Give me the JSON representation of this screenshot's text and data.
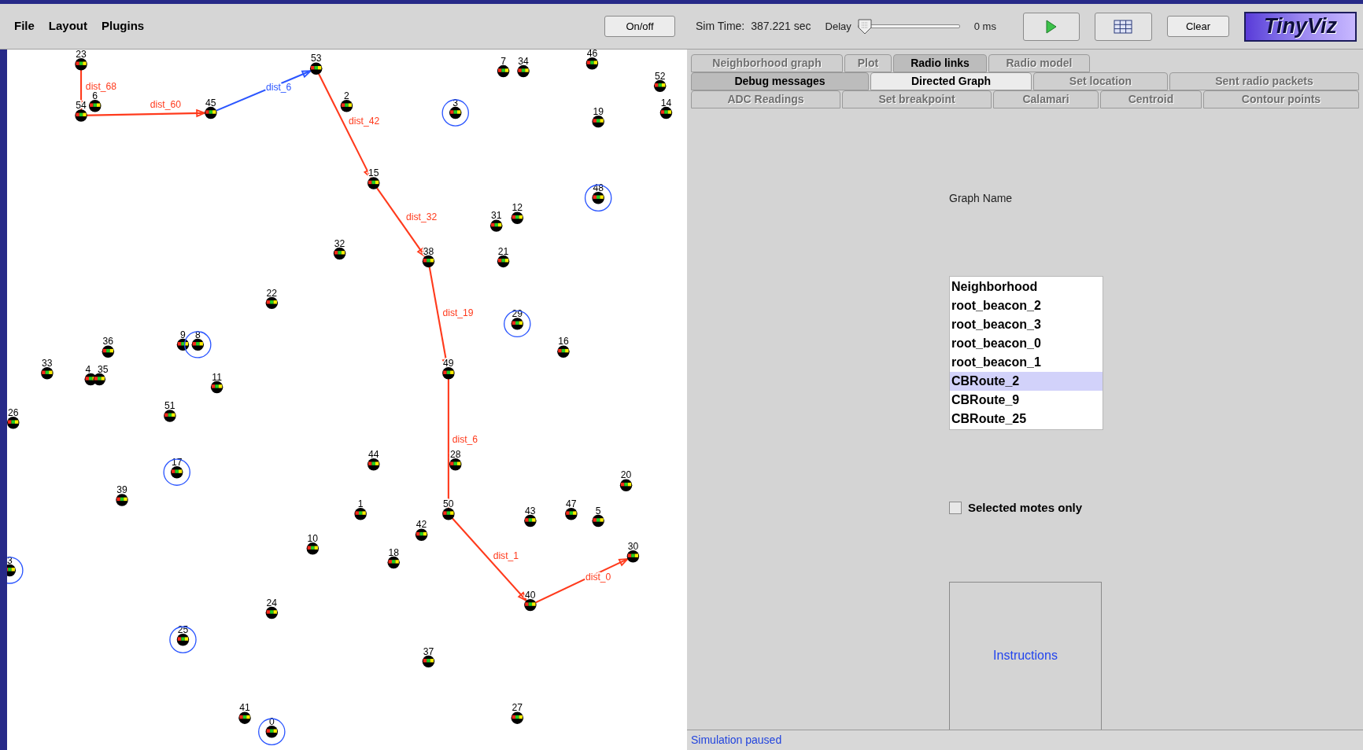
{
  "menu": [
    {
      "label": "File"
    },
    {
      "label": "Layout"
    },
    {
      "label": "Plugins"
    }
  ],
  "toolbar": {
    "power_button": "On/off",
    "sim_time_label": "Sim Time:",
    "sim_time": "387.221 sec",
    "delay_label": "Delay",
    "delay": {
      "level": 0
    },
    "delay_reading": "0 ms",
    "clear_button": "Clear",
    "logo": "TinyViz"
  },
  "motes": [
    {
      "label": "23",
      "selected": false
    },
    {
      "label": "6",
      "selected": false
    },
    {
      "label": "54",
      "selected": false
    },
    {
      "label": "45",
      "selected": false
    },
    {
      "label": "53",
      "selected": false
    },
    {
      "label": "2",
      "selected": false
    },
    {
      "label": "3",
      "selected": true
    },
    {
      "label": "7",
      "selected": false
    },
    {
      "label": "34",
      "selected": false
    },
    {
      "label": "46",
      "selected": false
    },
    {
      "label": "52",
      "selected": false
    },
    {
      "label": "19",
      "selected": false
    },
    {
      "label": "14",
      "selected": false
    },
    {
      "label": "15",
      "selected": false
    },
    {
      "label": "48",
      "selected": true
    },
    {
      "label": "31",
      "selected": false
    },
    {
      "label": "12",
      "selected": false
    },
    {
      "label": "32",
      "selected": false
    },
    {
      "label": "38",
      "selected": false
    },
    {
      "label": "21",
      "selected": false
    },
    {
      "label": "22",
      "selected": false
    },
    {
      "label": "29",
      "selected": true
    },
    {
      "label": "36",
      "selected": false
    },
    {
      "label": "9",
      "selected": false
    },
    {
      "label": "8",
      "selected": true
    },
    {
      "label": "16",
      "selected": false
    },
    {
      "label": "33",
      "selected": false
    },
    {
      "label": "4",
      "selected": false
    },
    {
      "label": "35",
      "selected": false
    },
    {
      "label": "49",
      "selected": false
    },
    {
      "label": "11",
      "selected": false
    },
    {
      "label": "26",
      "selected": false
    },
    {
      "label": "51",
      "selected": false
    },
    {
      "label": "44",
      "selected": false
    },
    {
      "label": "28",
      "selected": false
    },
    {
      "label": "17",
      "selected": true
    },
    {
      "label": "20",
      "selected": false
    },
    {
      "label": "39",
      "selected": false
    },
    {
      "label": "1",
      "selected": false
    },
    {
      "label": "50",
      "selected": false
    },
    {
      "label": "43",
      "selected": false
    },
    {
      "label": "47",
      "selected": false
    },
    {
      "label": "5",
      "selected": false
    },
    {
      "label": "42",
      "selected": false
    },
    {
      "label": "10",
      "selected": false
    },
    {
      "label": "30",
      "selected": false
    },
    {
      "label": "18",
      "selected": false
    },
    {
      "label": "3",
      "selected": true
    },
    {
      "label": "40",
      "selected": false
    },
    {
      "label": "24",
      "selected": false
    },
    {
      "label": "25",
      "selected": true
    },
    {
      "label": "37",
      "selected": false
    },
    {
      "label": "41",
      "selected": false
    },
    {
      "label": "27",
      "selected": false
    },
    {
      "label": "0",
      "selected": true
    }
  ],
  "links": [
    {
      "label": "dist_68",
      "color": "#ff3a1c"
    },
    {
      "label": "dist_60",
      "color": "#ff3a1c"
    },
    {
      "label": "dist_6",
      "color": "#2a55ff"
    },
    {
      "label": "dist_42",
      "color": "#ff3a1c"
    },
    {
      "label": "dist_32",
      "color": "#ff3a1c"
    },
    {
      "label": "dist_19",
      "color": "#ff3a1c"
    },
    {
      "label": "dist_6",
      "color": "#ff3a1c"
    },
    {
      "label": "dist_1",
      "color": "#ff3a1c"
    },
    {
      "label": "dist_0",
      "color": "#ff3a1c"
    }
  ],
  "tabs": [
    [
      {
        "label": "Neighborhood graph",
        "selected": false,
        "disabled": true
      },
      {
        "label": "Plot",
        "selected": false,
        "disabled": true
      },
      {
        "label": "Radio links",
        "selected": false,
        "disabled": false
      },
      {
        "label": "Radio model",
        "selected": false,
        "disabled": true
      }
    ],
    [
      {
        "label": "Debug messages",
        "selected": false,
        "disabled": false
      },
      {
        "label": "Directed Graph",
        "selected": true,
        "disabled": false
      },
      {
        "label": "Set location",
        "selected": false,
        "disabled": true
      },
      {
        "label": "Sent radio packets",
        "selected": false,
        "disabled": true
      }
    ],
    [
      {
        "label": "ADC Readings",
        "selected": false,
        "disabled": true
      },
      {
        "label": "Set breakpoint",
        "selected": false,
        "disabled": true
      },
      {
        "label": "Calamari",
        "selected": false,
        "disabled": true
      },
      {
        "label": "Centroid",
        "selected": false,
        "disabled": true
      },
      {
        "label": "Contour points",
        "selected": false,
        "disabled": true
      }
    ]
  ],
  "graph_name_label": "Graph Name",
  "graphs": [
    {
      "label": "Neighborhood",
      "selected": false
    },
    {
      "label": "root_beacon_2",
      "selected": false
    },
    {
      "label": "root_beacon_3",
      "selected": false
    },
    {
      "label": "root_beacon_0",
      "selected": false
    },
    {
      "label": "root_beacon_1",
      "selected": false
    },
    {
      "label": "CBRoute_2",
      "selected": true
    },
    {
      "label": "CBRoute_9",
      "selected": false
    },
    {
      "label": "CBRoute_25",
      "selected": false
    }
  ],
  "selected_motes_only": {
    "label": "Selected motes only",
    "checked": false
  },
  "instructions_button": "Instructions",
  "status": "Simulation paused"
}
